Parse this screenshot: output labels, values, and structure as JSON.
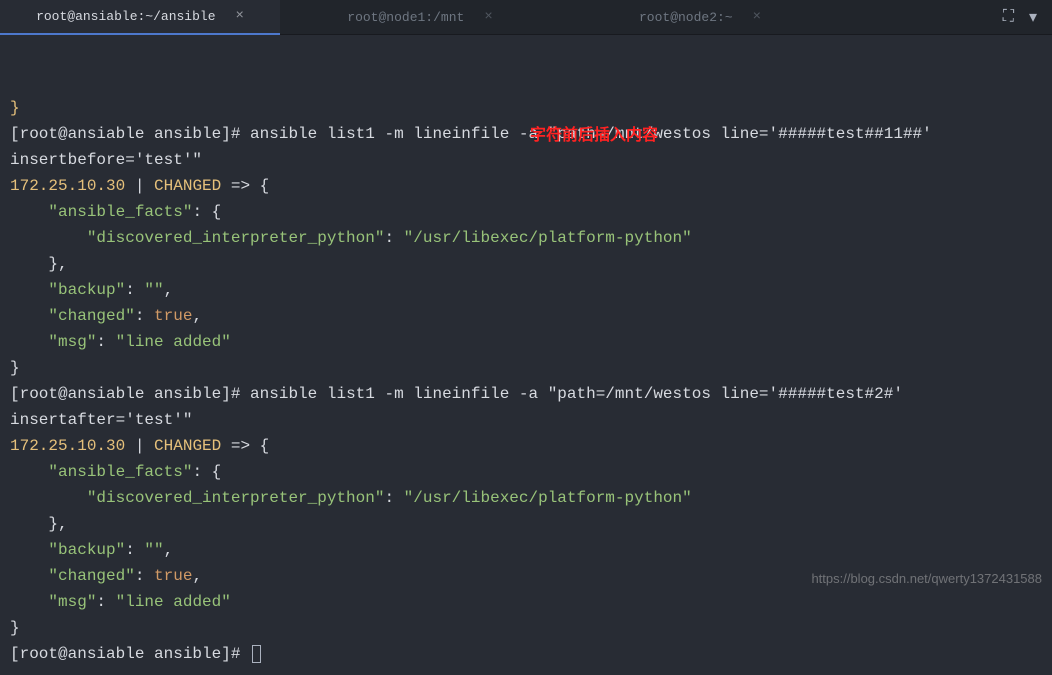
{
  "tabs": [
    {
      "label": "root@ansiable:~/ansible"
    },
    {
      "label": "root@node1:/mnt"
    },
    {
      "label": "root@node2:~"
    }
  ],
  "annotation": {
    "text": "字符前后插入内容"
  },
  "term": {
    "prefix_brace_top": "}",
    "prompt1_open": "[root@ansiable ansible]# ",
    "cmd1": "ansible list1 -m lineinfile -a \"path=/mnt/westos line='#####test##11##' insertbefore='test'\"",
    "res1_host": "172.25.10.30",
    "res1_pipe": " | ",
    "res1_status": "CHANGED",
    "res1_arrow": " => {",
    "facts_key": "    \"ansible_facts\"",
    "colon": ": ",
    "brace_open": "{",
    "interp_key": "        \"discovered_interpreter_python\"",
    "interp_val": "\"/usr/libexec/platform-python\"",
    "close_brace_comma": "    },",
    "backup_key": "    \"backup\"",
    "backup_val": "\"\"",
    "comma": ",",
    "changed_key": "    \"changed\"",
    "changed_val": "true",
    "msg_key": "    \"msg\"",
    "msg_val": "\"line added\"",
    "close_brace": "}",
    "prompt2_open": "[root@ansiable ansible]# ",
    "cmd2": "ansible list1 -m lineinfile -a \"path=/mnt/westos line='#####test#2#' insertafter='test'\"",
    "prompt3": "[root@ansiable ansible]# "
  },
  "watermark": "https://blog.csdn.net/qwerty1372431588",
  "icons": {
    "screenshot": "⛶",
    "chevron": "▾"
  }
}
